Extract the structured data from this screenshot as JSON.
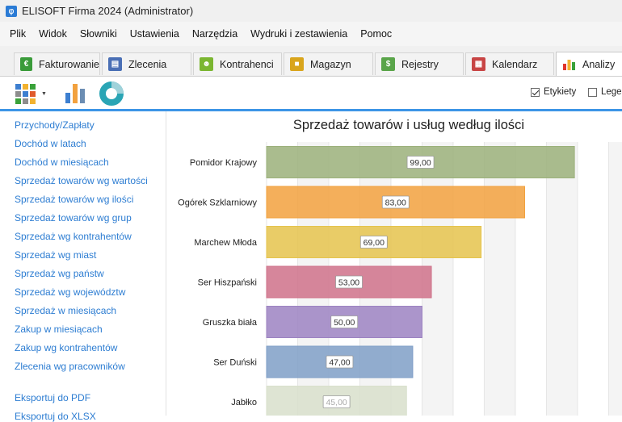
{
  "window": {
    "title": "ELISOFT Firma 2024 (Administrator)",
    "icon": "app-logo-icon"
  },
  "menu": [
    "Plik",
    "Widok",
    "Słowniki",
    "Ustawienia",
    "Narzędzia",
    "Wydruki i zestawienia",
    "Pomoc"
  ],
  "tabs": [
    {
      "label": "Fakturowanie",
      "icon": "euro-icon",
      "color": "#3a9b3a"
    },
    {
      "label": "Zlecenia",
      "icon": "documents-icon",
      "color": "#4a6fb5"
    },
    {
      "label": "Kontrahenci",
      "icon": "people-icon",
      "color": "#7bb631"
    },
    {
      "label": "Magazyn",
      "icon": "boxes-icon",
      "color": "#d9a51c"
    },
    {
      "label": "Rejestry",
      "icon": "register-icon",
      "color": "#5aa54a"
    },
    {
      "label": "Kalendarz",
      "icon": "calendar-icon",
      "color": "#c84545"
    },
    {
      "label": "Analizy",
      "icon": "bar-chart-icon",
      "color": "#e0352b",
      "active": true
    }
  ],
  "toolbar": {
    "buttons": [
      "tiles-view-icon",
      "bar-chart-icon",
      "donut-chart-icon"
    ],
    "labels_checkbox": {
      "label": "Etykiety",
      "checked": true
    },
    "legend_checkbox": {
      "label": "Legenda",
      "checked": false
    }
  },
  "reports": [
    "Przychody/Zapłaty",
    "Dochód w latach",
    "Dochód w miesiącach",
    "Sprzedaż towarów wg wartości",
    "Sprzedaż towarów wg ilości",
    "Sprzedaż towarów wg grup",
    "Sprzedaż wg kontrahentów",
    "Sprzedaż wg miast",
    "Sprzedaż wg państw",
    "Sprzedaż wg województw",
    "Sprzedaż w miesiącach",
    "Zakup w miesiącach",
    "Zakup wg kontrahentów",
    "Zlecenia wg pracowników"
  ],
  "exports": [
    "Eksportuj do PDF",
    "Eksportuj do XLSX"
  ],
  "chart_data": {
    "type": "bar",
    "orientation": "horizontal",
    "title": "Sprzedaż towarów i usług według ilości",
    "categories": [
      "Pomidor Krajowy",
      "Ogórek Szklarniowy",
      "Marchew Młoda",
      "Ser Hiszpański",
      "Gruszka biała",
      "Ser Duński",
      "Jabłko"
    ],
    "values": [
      99,
      83,
      69,
      53,
      50,
      47,
      45
    ],
    "value_labels": [
      "99,00",
      "83,00",
      "69,00",
      "53,00",
      "50,00",
      "47,00",
      "45,00"
    ],
    "colors": [
      "#9bb07a",
      "#f2a13e",
      "#e5c34c",
      "#cf7189",
      "#9c83c2",
      "#7f9fc7",
      "#d8dfcb"
    ],
    "grid": true,
    "xlim": [
      0,
      113
    ]
  }
}
